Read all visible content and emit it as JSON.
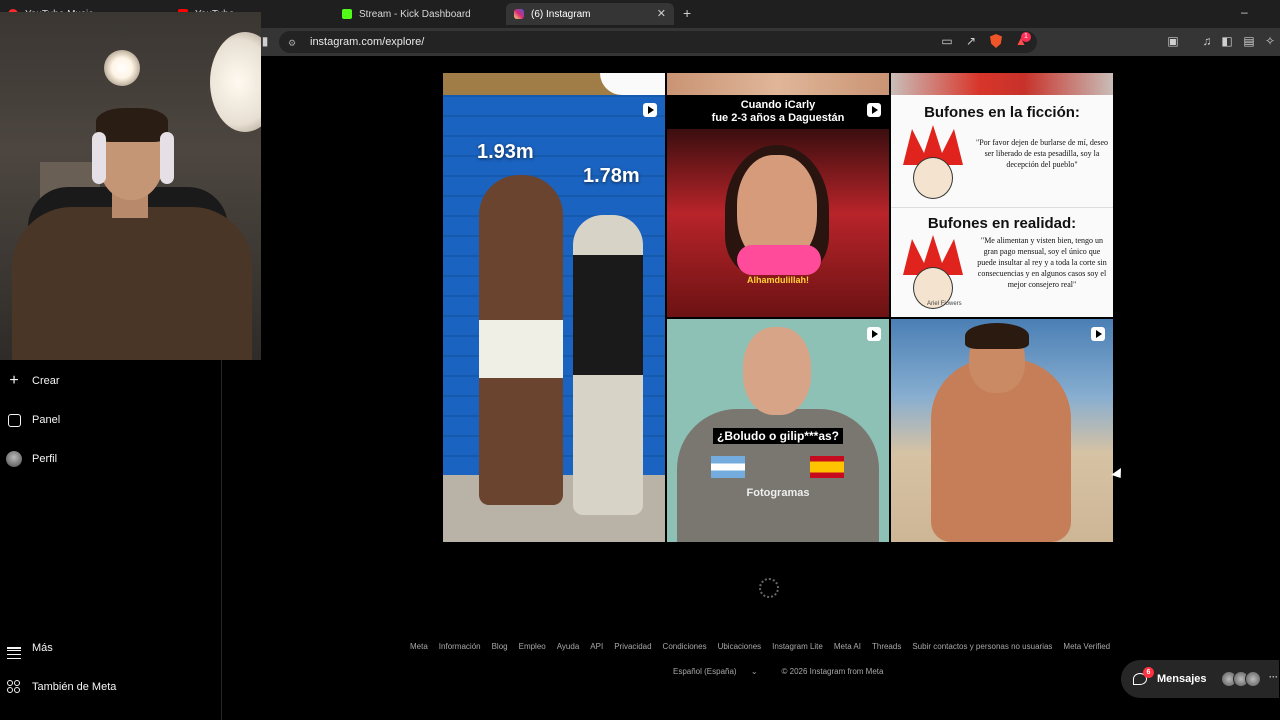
{
  "browser": {
    "tabs": [
      {
        "label": "YouTube Music",
        "active": false
      },
      {
        "label": "YouTube",
        "active": false
      },
      {
        "label": "Stream - Kick Dashboard",
        "active": false
      },
      {
        "label": "(6) Instagram",
        "active": true
      }
    ],
    "url": "instagram.com/explore/",
    "notification_count": "1"
  },
  "sidebar": {
    "items": [
      {
        "label": "Crear",
        "icon": "plus-icon"
      },
      {
        "label": "Panel",
        "icon": "panel-icon"
      },
      {
        "label": "Perfil",
        "icon": "avatar"
      }
    ],
    "bottom": [
      {
        "label": "Más",
        "icon": "menu-icon"
      },
      {
        "label": "También de Meta",
        "icon": "meta-icon"
      }
    ]
  },
  "explore": {
    "tile1": {
      "tag_left": "1.93m",
      "tag_right": "1.78m"
    },
    "tile2": {
      "caption_line1": "Cuando iCarly",
      "caption_line2": "fue 2-3 años a Daguestán",
      "subtitle": "Alhamdulillah!"
    },
    "tile3": {
      "heading1": "Bufones en la ficción:",
      "quote1": "\"Por favor dejen de burlarse de mí, deseo ser liberado de esta pesadilla, soy la decepción del pueblo\"",
      "heading2": "Bufones en realidad:",
      "quote2": "\"Me alimentan y visten bien, tengo un gran pago mensual, soy el único que puede insultar al rey y a toda la corte sin consecuencias y en algunos casos soy el mejor consejero real\"",
      "credit": "Ariel Flowers"
    },
    "tile4": {
      "caption": "¿Boludo o gilip***as?",
      "brand": "Fotogramas"
    }
  },
  "footer": {
    "links": [
      "Meta",
      "Información",
      "Blog",
      "Empleo",
      "Ayuda",
      "API",
      "Privacidad",
      "Condiciones",
      "Ubicaciones",
      "Instagram Lite",
      "Meta AI",
      "Threads",
      "Subir contactos y personas no usuarias",
      "Meta Verified"
    ],
    "language": "Español (España)",
    "copyright": "© 2026 Instagram from Meta"
  },
  "messages": {
    "label": "Mensajes",
    "count": "6"
  },
  "colors": {
    "accent": "#ff3040",
    "background": "#000000"
  }
}
